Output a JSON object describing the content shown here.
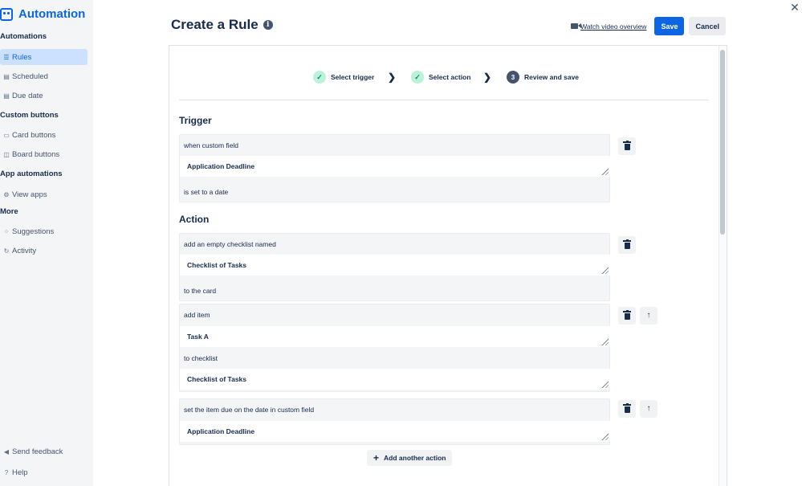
{
  "sidebar": {
    "title": "Automation",
    "sections": {
      "automations": "Automations",
      "custom_buttons": "Custom buttons",
      "app_automations": "App automations",
      "more": "More"
    },
    "items": {
      "rules": "Rules",
      "scheduled": "Scheduled",
      "due_date": "Due date",
      "card_buttons": "Card buttons",
      "board_buttons": "Board buttons",
      "view_apps": "View apps",
      "suggestions": "Suggestions",
      "activity": "Activity"
    },
    "footer": {
      "send_feedback": "Send feedback",
      "help": "Help"
    }
  },
  "header": {
    "title": "Create a Rule",
    "info_glyph": "i",
    "watch_video": "Watch video overview",
    "save": "Save",
    "cancel": "Cancel",
    "close_glyph": "✕"
  },
  "stepper": {
    "steps": [
      {
        "label": "Select trigger",
        "state": "done",
        "glyph": "✓"
      },
      {
        "label": "Select action",
        "state": "done",
        "glyph": "✓"
      },
      {
        "label": "Review and save",
        "state": "current",
        "glyph": "3"
      }
    ],
    "arrow_glyph": "❯"
  },
  "trigger": {
    "heading": "Trigger",
    "line1": "when custom field",
    "field": "Application Deadline",
    "line2": "is set to a date"
  },
  "action": {
    "heading": "Action",
    "cards": [
      {
        "line1": "add an empty checklist named",
        "field": "Checklist of Tasks",
        "line2": "to the card"
      },
      {
        "line1": "add item",
        "field1": "Task A",
        "line2": "to checklist",
        "field2": "Checklist of Tasks"
      },
      {
        "line1": "set the item due on the date in custom field",
        "field": "Application Deadline"
      }
    ],
    "up_glyph": "↑",
    "add_plus": "+",
    "add_another": "Add another action"
  },
  "colors": {
    "brand": "#0c66e4",
    "sidebar_bg": "#f4f5f7",
    "active_bg": "#cce0ff",
    "step_done_bg": "#baf3db",
    "step_current_bg": "#44546f"
  }
}
